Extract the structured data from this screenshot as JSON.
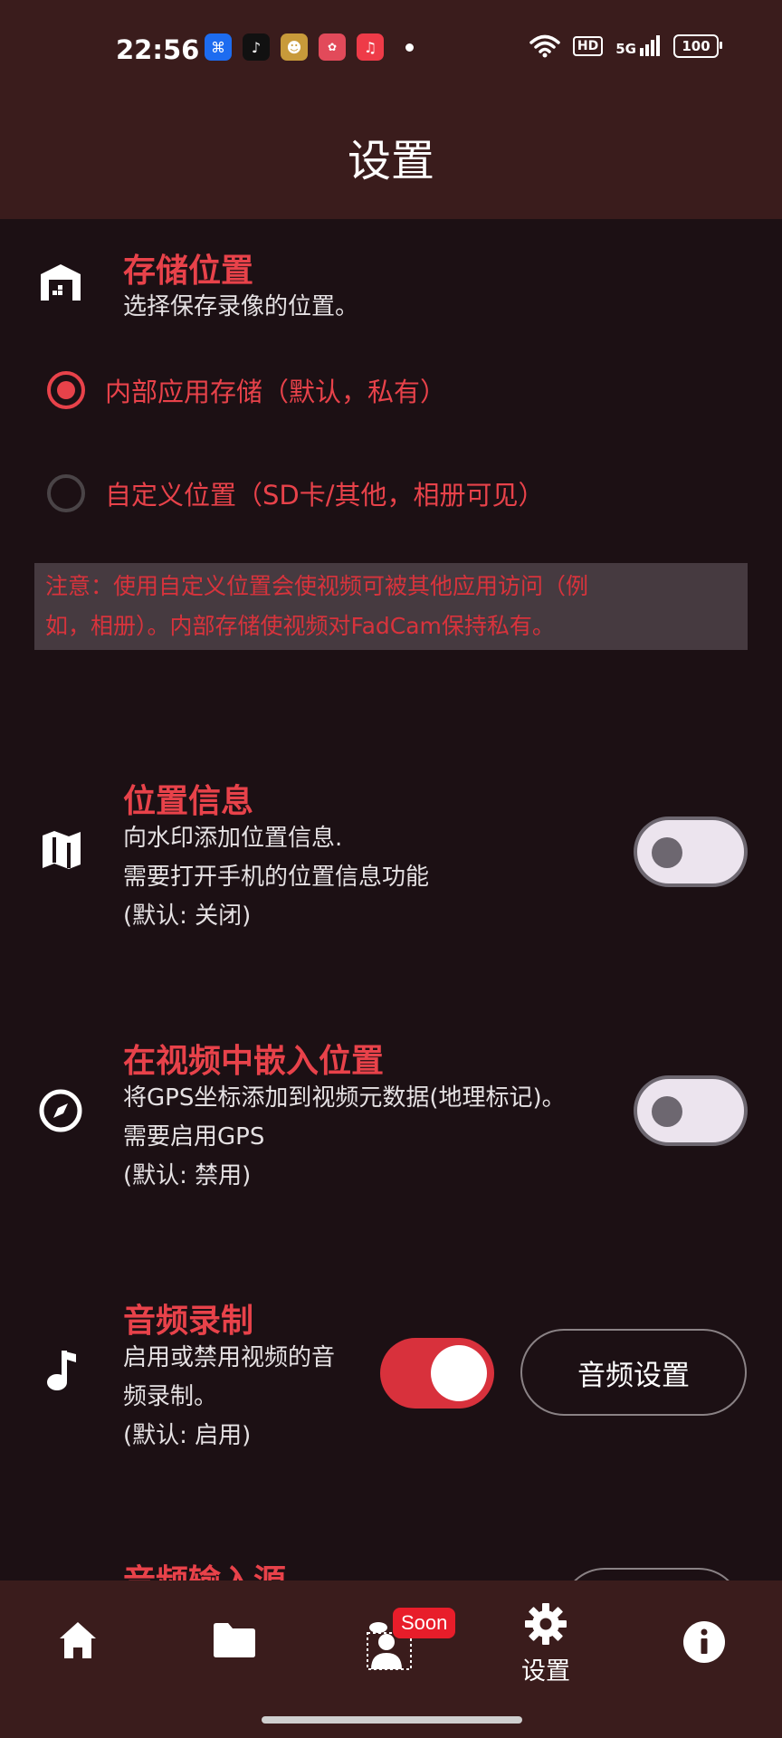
{
  "status_bar": {
    "time": "22:56",
    "notification_icons": [
      "app-icon",
      "tiktok-icon",
      "game-icon",
      "618-icon",
      "music-icon"
    ],
    "hd": "HD",
    "network": "5G",
    "battery": "100"
  },
  "app_bar": {
    "title": "设置"
  },
  "storage": {
    "title": "存储位置",
    "desc": "选择保存录像的位置。",
    "options": [
      {
        "label": "内部应用存储（默认，私有）",
        "selected": true
      },
      {
        "label": "自定义位置（SD卡/其他，相册可见）",
        "selected": false
      }
    ],
    "note_line1": "注意：使用自定义位置会使视频可被其他应用访问（例",
    "note_line2": "如，相册）。内部存储使视频对FadCam保持私有。"
  },
  "location": {
    "title": "位置信息",
    "desc1": "向水印添加位置信息.",
    "desc2": "需要打开手机的位置信息功能",
    "desc3": "(默认: 关闭)",
    "enabled": false
  },
  "embed_location": {
    "title": "在视频中嵌入位置",
    "desc1": "将GPS坐标添加到视频元数据(地理标记)。",
    "desc2": "需要启用GPS",
    "desc3": "(默认: 禁用)",
    "enabled": false
  },
  "audio": {
    "title": "音频录制",
    "desc1": "启用或禁用视频的音",
    "desc2": "频录制。",
    "desc3": "(默认: 启用)",
    "enabled": true,
    "settings_button": "音频设置"
  },
  "audio_source": {
    "title": "音频输入源"
  },
  "bottom_nav": {
    "items": [
      {
        "icon": "home-icon"
      },
      {
        "icon": "folder-icon"
      },
      {
        "icon": "remote-icon",
        "badge": "Soon"
      },
      {
        "icon": "gear-icon",
        "label": "设置",
        "active": true
      },
      {
        "icon": "info-icon"
      }
    ]
  },
  "colors": {
    "accent": "#e8424a",
    "bar_background": "#3a1c1c",
    "page_background": "#1c1014"
  }
}
